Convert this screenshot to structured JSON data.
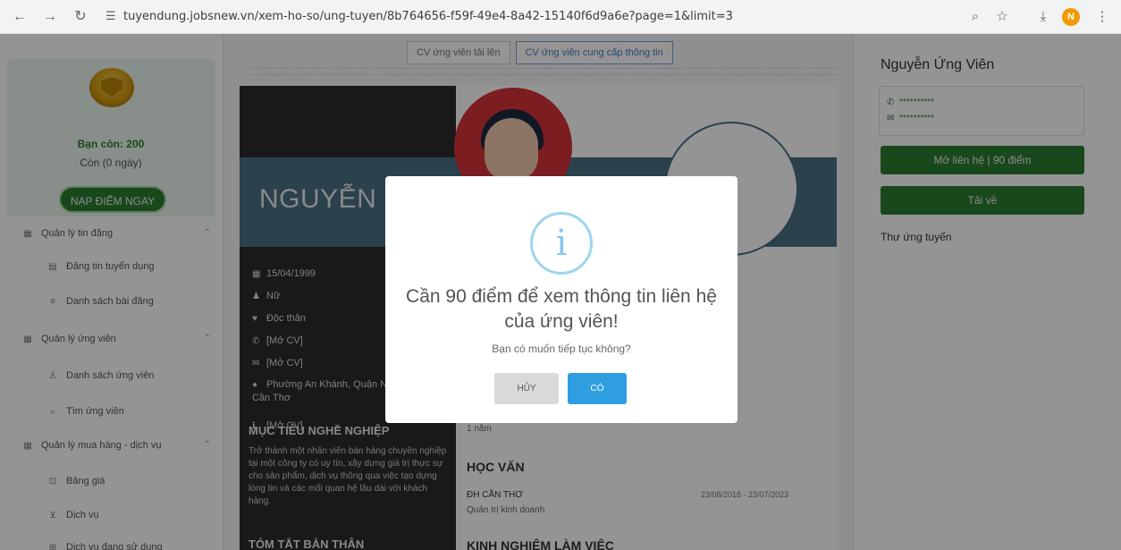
{
  "browser": {
    "url": "tuyendung.jobsnew.vn/xem-ho-so/ung-tuyen/8b764656-f59f-49e4-8a42-15140f6d9a6e?page=1&limit=3",
    "profile_initial": "N"
  },
  "sidebar": {
    "balance": "Bạn còn: 200",
    "days": "Còn (0 ngày)",
    "topup_label": "NẠP ĐIỂM NGAY",
    "items": [
      {
        "label": "Quản lý tin đăng",
        "group": true
      },
      {
        "label": "Đăng tin tuyển dụng",
        "group": false
      },
      {
        "label": "Danh sách bài đăng",
        "group": false
      },
      {
        "label": "Quản lý ứng viên",
        "group": true
      },
      {
        "label": "Danh sách ứng viên",
        "group": false
      },
      {
        "label": "Tìm ứng viên",
        "group": false
      },
      {
        "label": "Quản lý mua hàng - dịch vụ",
        "group": true
      },
      {
        "label": "Bảng giá",
        "group": false
      },
      {
        "label": "Dịch vụ",
        "group": false
      },
      {
        "label": "Dịch vụ đang sử dụng",
        "group": false
      }
    ]
  },
  "tabs": [
    {
      "label": "CV ứng viên tải lên",
      "active": false
    },
    {
      "label": "CV ứng viên cung cấp thông tin",
      "active": true
    }
  ],
  "cv": {
    "name": "NGUYỄN ỨNG VIÊN",
    "birthdate": "15/04/1999",
    "gender": "Nữ",
    "marital": "Độc thân",
    "phone": "[Mở CV]",
    "email": "[Mở CV]",
    "address": "Phường An Khánh, Quận Ninh Kiều, Cần Thơ",
    "other": "[Mở CV]",
    "objective_title": "MỤC TIÊU NGHỀ NGHIỆP",
    "objective": "Trở thành một nhân viên bán hàng chuyên nghiệp tại một công ty có uy tín, xây dựng giá trị thực sự cho sản phẩm, dịch vụ thông qua việc tạo dựng lòng tin và các mối quan hệ lâu dài với khách hàng.",
    "summary_title": "TÓM TẮT BẢN THÂN",
    "experience_years": "1 năm",
    "education_title": "HỌC VẤN",
    "school": "ĐH CẦN THƠ",
    "edu_dates": "23/08/2018 - 23/07/2023",
    "major": "Quản trị kinh doanh",
    "work_title": "KINH NGHIỆM LÀM VIỆC"
  },
  "right": {
    "candidate_name": "Nguyễn Ứng Viên",
    "phone_masked": "**********",
    "email_masked": "**********",
    "open_contact_label": "Mở liên hệ | 90 điểm",
    "download_label": "Tải về",
    "letter_label": "Thư ứng tuyển"
  },
  "modal": {
    "icon": "i",
    "title": "Cần 90 điểm để xem thông tin liên hệ của ứng viên!",
    "text": "Bạn có muốn tiếp tục không?",
    "cancel_label": "HỦY",
    "ok_label": "CÓ"
  },
  "colors": {
    "brand_green": "#2e7d32",
    "cv_band": "#4a7083",
    "avatar_red": "#d4323a",
    "confirm_blue": "#2f9ee0"
  }
}
